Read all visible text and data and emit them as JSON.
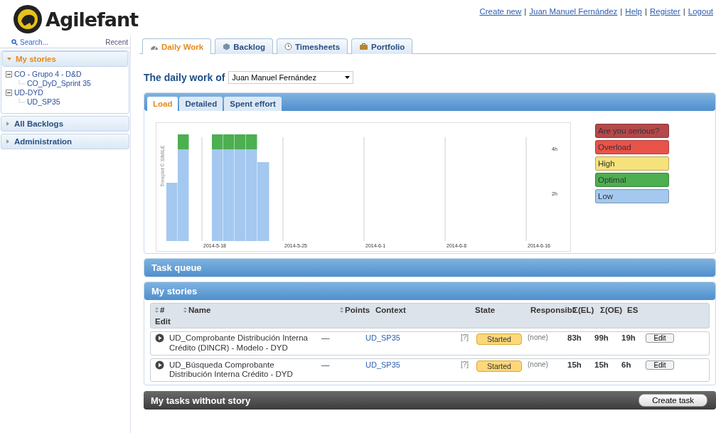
{
  "header": {
    "logo_text": "Agilefant",
    "links": [
      {
        "label": "Create new"
      },
      {
        "label": "Juan Manuel Fernández"
      },
      {
        "label": "Help"
      },
      {
        "label": "Register"
      },
      {
        "label": "Logout"
      }
    ],
    "separator": "|"
  },
  "sidebar": {
    "search": {
      "placeholder": "Search..."
    },
    "recent": "Recent",
    "sections": [
      {
        "title": "My stories",
        "expanded": true,
        "tree": [
          {
            "label": "CO - Grupo 4 - D&D",
            "expanded": true,
            "children": [
              {
                "label": "CO_DyD_Sprint 35"
              }
            ]
          },
          {
            "label": "UD-DYD",
            "expanded": true,
            "children": [
              {
                "label": "UD_SP35"
              }
            ]
          }
        ]
      },
      {
        "title": "All Backlogs",
        "expanded": false
      },
      {
        "title": "Administration",
        "expanded": false
      }
    ]
  },
  "tabs": [
    {
      "label": "Daily Work",
      "selected": true
    },
    {
      "label": "Backlog",
      "selected": false
    },
    {
      "label": "Timesheets",
      "selected": false
    },
    {
      "label": "Portfolio",
      "selected": false
    }
  ],
  "daily_work": {
    "title": "The daily work of",
    "user": "Juan Manuel Fernández"
  },
  "load_panel": {
    "tabs": [
      {
        "label": "Load",
        "selected": true
      },
      {
        "label": "Detailed",
        "selected": false
      },
      {
        "label": "Spent effort",
        "selected": false
      }
    ],
    "credit": "Timeplot © SIMILE",
    "timeplot": {
      "date_labels": [
        "2014-5-18",
        "2014-5-25",
        "2014-6-1",
        "2014-6-8",
        "2014-6-16"
      ],
      "hour_labels": [
        "4h",
        "2h"
      ]
    },
    "legend": [
      {
        "label": "Are you serious?",
        "color": "#b5484b"
      },
      {
        "label": "Overload",
        "color": "#e8534a"
      },
      {
        "label": "High",
        "color": "#f5e27a"
      },
      {
        "label": "Optimal",
        "color": "#4caf50"
      },
      {
        "label": "Low",
        "color": "#a4c8f0"
      }
    ]
  },
  "task_queue": {
    "title": "Task queue"
  },
  "my_stories": {
    "title": "My stories",
    "columns": [
      {
        "label": "#",
        "sortable": true
      },
      {
        "label": "Name",
        "sortable": true
      },
      {
        "label": "Points",
        "sortable": true
      },
      {
        "label": "Context",
        "sortable": false
      },
      {
        "label": "State",
        "sortable": false
      },
      {
        "label": "Responsibl",
        "sortable": false
      },
      {
        "label": "Σ(EL)",
        "sortable": false
      },
      {
        "label": "Σ(OE)",
        "sortable": false
      },
      {
        "label": "ES",
        "sortable": false
      },
      {
        "label": "Edit",
        "sortable": false
      }
    ],
    "rows": [
      {
        "name": "UD_Comprobante Distribución Interna Crédito (DINCR) - Modelo - DYD",
        "points": "—",
        "context": "UD_SP35",
        "info": "[?]",
        "state": "Started",
        "responsible": "(none)",
        "el": "83h",
        "oe": "99h",
        "es": "19h",
        "edit": "Edit"
      },
      {
        "name": "UD_Búsqueda Comprobante Distribución Interna Crédito - DYD",
        "points": "—",
        "context": "UD_SP35",
        "info": "[?]",
        "state": "Started",
        "responsible": "(none)",
        "el": "15h",
        "oe": "15h",
        "es": "6h",
        "edit": "Edit"
      }
    ]
  },
  "tasks_without_story": {
    "title": "My tasks without story",
    "button": "Create task"
  }
}
